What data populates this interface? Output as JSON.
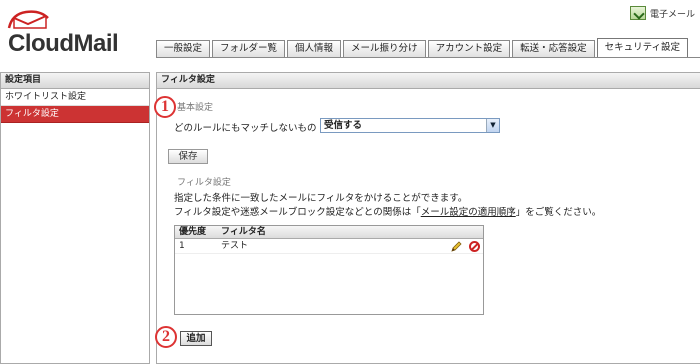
{
  "header": {
    "logo_text": "CloudMail",
    "mail_link": "電子メール"
  },
  "tabs": [
    {
      "label": "一般設定",
      "active": false
    },
    {
      "label": "フォルダー覧",
      "active": false
    },
    {
      "label": "個人情報",
      "active": false
    },
    {
      "label": "メール振り分け",
      "active": false
    },
    {
      "label": "アカウント設定",
      "active": false
    },
    {
      "label": "転送・応答設定",
      "active": false
    },
    {
      "label": "セキュリティ設定",
      "active": true
    }
  ],
  "sidebar": {
    "title": "設定項目",
    "items": [
      {
        "label": "ホワイトリスト設定",
        "active": false
      },
      {
        "label": "フィルタ設定",
        "active": true
      }
    ]
  },
  "main": {
    "title": "フィルタ設定",
    "basic": {
      "legend": "基本設定",
      "nomatch_label": "どのルールにもマッチしないもの",
      "nomatch_value": "受信する",
      "save_label": "保存"
    },
    "filter": {
      "legend": "フィルタ設定",
      "desc1": "指定した条件に一致したメールにフィルタをかけることができます。",
      "desc2_before": "フィルタ設定や迷惑メールブロック設定などとの関係は「",
      "desc2_link": "メール設定の適用順序",
      "desc2_after": "」をご覧ください。",
      "columns": [
        "優先度",
        "フィルタ名"
      ],
      "rows": [
        {
          "priority": "1",
          "name": "テスト"
        }
      ],
      "add_label": "追加"
    }
  },
  "markers": [
    "1",
    "2"
  ],
  "colors": {
    "accent": "#cc3333",
    "marker": "#dd3333"
  }
}
